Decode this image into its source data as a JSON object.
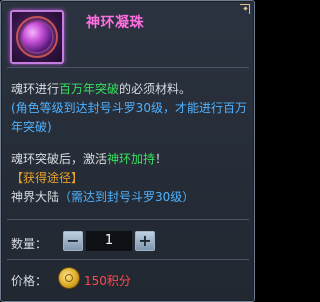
{
  "item": {
    "title": "神环凝珠",
    "icon": "orb-icon"
  },
  "description": {
    "line1_pre": "魂环进行",
    "line1_highlight": "百万年突破",
    "line1_post": "的必须材料。",
    "requirement": "(角色等级到达封号斗罗30级，才能进行百万年突破)"
  },
  "effect": {
    "pre": "魂环突破后，激活",
    "highlight": "神环加持",
    "post": "！"
  },
  "source": {
    "header": "【获得途径】",
    "place": "神界大陆",
    "requirement": "（需达到封号斗罗30级）"
  },
  "quantity": {
    "label": "数量：",
    "value": "1",
    "minus": "−",
    "plus": "+"
  },
  "price": {
    "label": "价格：",
    "value": "150积分",
    "icon": "coin-icon"
  },
  "colors": {
    "title": "#ff6fe0",
    "highlight": "#39e05f",
    "requirement": "#4fb2ff",
    "source_header": "#e7a12b",
    "price": "#ff4a4a"
  }
}
